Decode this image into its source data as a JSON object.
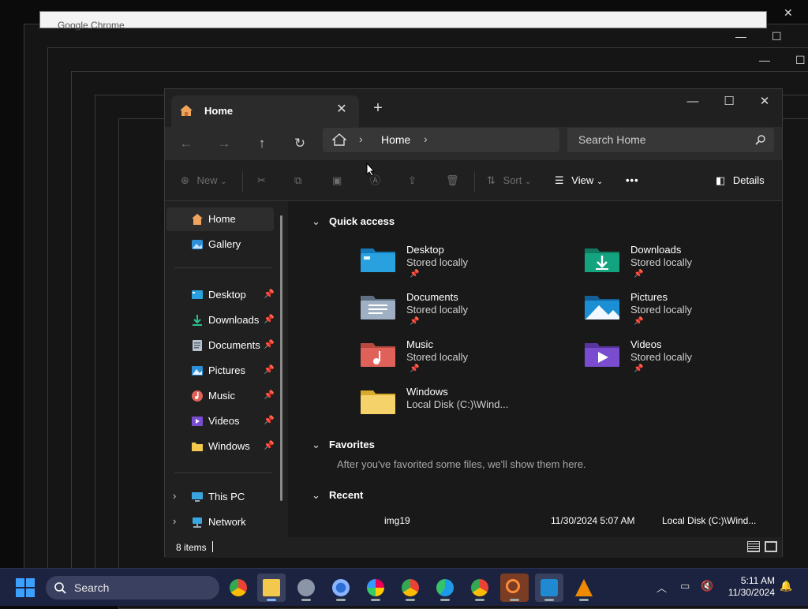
{
  "background": {
    "top_window_title": "Google Chrome"
  },
  "window": {
    "tab_title": "Home",
    "tab_close": "✕",
    "new_tab": "+",
    "minimize": "—",
    "maximize": "☐",
    "close": "✕"
  },
  "nav": {
    "back": "←",
    "forward": "→",
    "up": "↑",
    "refresh": "↻",
    "breadcrumb": "Home",
    "search_placeholder": "Search Home"
  },
  "toolbar": {
    "new_label": "New",
    "sort_label": "Sort",
    "view_label": "View",
    "more_label": "•••",
    "details_label": "Details"
  },
  "sidebar": {
    "top_items": [
      {
        "label": "Home",
        "icon": "home-icon"
      },
      {
        "label": "Gallery",
        "icon": "gallery-icon"
      }
    ],
    "pinned_items": [
      {
        "label": "Desktop",
        "icon": "desktop-icon"
      },
      {
        "label": "Downloads",
        "icon": "downloads-icon"
      },
      {
        "label": "Documents",
        "icon": "documents-icon"
      },
      {
        "label": "Pictures",
        "icon": "pictures-icon"
      },
      {
        "label": "Music",
        "icon": "music-icon"
      },
      {
        "label": "Videos",
        "icon": "videos-icon"
      },
      {
        "label": "Windows",
        "icon": "folder-icon"
      }
    ],
    "bottom_items": [
      {
        "label": "This PC",
        "icon": "pc-icon"
      },
      {
        "label": "Network",
        "icon": "network-icon"
      }
    ]
  },
  "main": {
    "quick_access": {
      "title": "Quick access",
      "items": [
        {
          "name": "Desktop",
          "sub": "Stored locally",
          "color": "#1a9ad6"
        },
        {
          "name": "Downloads",
          "sub": "Stored locally",
          "color": "#14a37f"
        },
        {
          "name": "Documents",
          "sub": "Stored locally",
          "color": "#7d8ea3"
        },
        {
          "name": "Pictures",
          "sub": "Stored locally",
          "color": "#1b8fd4"
        },
        {
          "name": "Music",
          "sub": "Stored locally",
          "color": "#e0615a"
        },
        {
          "name": "Videos",
          "sub": "Stored locally",
          "color": "#7a4ccf"
        },
        {
          "name": "Windows",
          "sub": "Local Disk (C:)\\Wind...",
          "color": "#f2c94c"
        }
      ]
    },
    "favorites": {
      "title": "Favorites",
      "message": "After you've favorited some files, we'll show them here."
    },
    "recent": {
      "title": "Recent",
      "rows": [
        {
          "name": "img19",
          "date": "11/30/2024 5:07 AM",
          "location": "Local Disk (C:)\\Wind..."
        }
      ]
    }
  },
  "status": {
    "count": "8 items"
  },
  "taskbar": {
    "search_placeholder": "Search",
    "time": "5:11 AM",
    "date": "11/30/2024"
  }
}
